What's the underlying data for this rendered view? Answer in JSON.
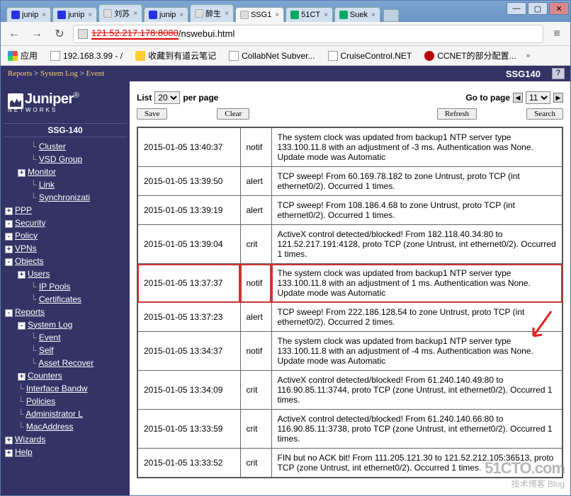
{
  "window": {
    "tabs": [
      {
        "label": "junip",
        "fav": "baidu"
      },
      {
        "label": "junip",
        "fav": "baidu"
      },
      {
        "label": "刘苏",
        "fav": "page"
      },
      {
        "label": "junip",
        "fav": "baidu"
      },
      {
        "label": "醉生",
        "fav": "page"
      },
      {
        "label": "SSG1",
        "fav": "page",
        "active": true
      },
      {
        "label": "51CT",
        "fav": "cto"
      },
      {
        "label": "Suek",
        "fav": "cto"
      }
    ],
    "url_prefix": "121.52.217.178:8080",
    "url_suffix": "/nswebui.html"
  },
  "bookmarks": {
    "apps": "应用",
    "items": [
      {
        "label": "192.168.3.99 - /",
        "icon": "page"
      },
      {
        "label": "收藏到有道云笔记",
        "icon": "folder"
      },
      {
        "label": "CollabNet Subver...",
        "icon": "page"
      },
      {
        "label": "CruiseControl.NET",
        "icon": "page"
      },
      {
        "label": "CCNET的部分配置...",
        "icon": "dot"
      }
    ]
  },
  "header": {
    "breadcrumb_parts": [
      "Reports",
      "System Log",
      "Event"
    ],
    "device": "SSG140",
    "help": "?"
  },
  "sidebar": {
    "logo_text": "Juniper",
    "logo_sub": "NETWORKS",
    "title": "SSG-140",
    "tree": [
      {
        "lvl": 2,
        "box": "",
        "label": "Cluster"
      },
      {
        "lvl": 2,
        "box": "",
        "label": "VSD Group"
      },
      {
        "lvl": 1,
        "box": "+",
        "label": "Monitor"
      },
      {
        "lvl": 2,
        "box": "",
        "label": "Link"
      },
      {
        "lvl": 2,
        "box": "",
        "label": "Synchronizati"
      },
      {
        "lvl": 0,
        "box": "+",
        "label": "PPP"
      },
      {
        "lvl": 0,
        "box": "-",
        "label": "Security"
      },
      {
        "lvl": 0,
        "box": "-",
        "label": "Policy"
      },
      {
        "lvl": 0,
        "box": "+",
        "label": "VPNs"
      },
      {
        "lvl": 0,
        "box": "-",
        "label": "Objects"
      },
      {
        "lvl": 1,
        "box": "+",
        "label": "Users"
      },
      {
        "lvl": 2,
        "box": "",
        "label": "IP Pools"
      },
      {
        "lvl": 2,
        "box": "",
        "label": "Certificates"
      },
      {
        "lvl": 0,
        "box": "-",
        "label": "Reports"
      },
      {
        "lvl": 1,
        "box": "-",
        "label": "System Log"
      },
      {
        "lvl": 2,
        "box": "",
        "label": "Event"
      },
      {
        "lvl": 2,
        "box": "",
        "label": "Self"
      },
      {
        "lvl": 2,
        "box": "",
        "label": "Asset Recover"
      },
      {
        "lvl": 1,
        "box": "+",
        "label": "Counters"
      },
      {
        "lvl": 1,
        "box": "",
        "label": "Interface Bandw"
      },
      {
        "lvl": 1,
        "box": "",
        "label": "Policies"
      },
      {
        "lvl": 1,
        "box": "",
        "label": "Administrator L"
      },
      {
        "lvl": 1,
        "box": "",
        "label": "MacAddress"
      },
      {
        "lvl": 0,
        "box": "+",
        "label": "Wizards"
      },
      {
        "lvl": 0,
        "box": "+",
        "label": "Help"
      }
    ]
  },
  "controls": {
    "list_label": "List",
    "per_page_value": "20",
    "per_page_suffix": "per page",
    "goto_label": "Go to page",
    "page_value": "11",
    "save": "Save",
    "clear": "Clear",
    "refresh": "Refresh",
    "search": "Search"
  },
  "log_rows": [
    {
      "time": "2015-01-05 13:40:37",
      "level": "notif",
      "msg": "The system clock was updated from backup1 NTP server type 133.100.11.8 with an adjustment of -3 ms. Authentication was None. Update mode was Automatic"
    },
    {
      "time": "2015-01-05 13:39:50",
      "level": "alert",
      "msg": "TCP sweep! From 60.169.78.182 to zone Untrust, proto TCP (int ethernet0/2). Occurred 1 times."
    },
    {
      "time": "2015-01-05 13:39:19",
      "level": "alert",
      "msg": "TCP sweep! From 108.186.4.68 to zone Untrust, proto TCP (int ethernet0/2). Occurred 1 times."
    },
    {
      "time": "2015-01-05 13:39:04",
      "level": "crit",
      "msg": "ActiveX control detected/blocked! From 182.118.40.34:80 to 121.52.217.191:4128, proto TCP (zone Untrust, int ethernet0/2). Occurred 1 times."
    },
    {
      "time": "2015-01-05 13:37:37",
      "level": "notif",
      "msg": "The system clock was updated from backup1 NTP server type 133.100.11.8 with an adjustment of 1 ms. Authentication was None. Update mode was Automatic",
      "hl": true
    },
    {
      "time": "2015-01-05 13:37:23",
      "level": "alert",
      "msg": "TCP sweep! From 222.186.128.54 to zone Untrust, proto TCP (int ethernet0/2). Occurred 2 times."
    },
    {
      "time": "2015-01-05 13:34:37",
      "level": "notif",
      "msg": "The system clock was updated from backup1 NTP server type 133.100.11.8 with an adjustment of -4 ms. Authentication was None. Update mode was Automatic"
    },
    {
      "time": "2015-01-05 13:34:09",
      "level": "crit",
      "msg": "ActiveX control detected/blocked! From 61.240.140.49:80 to 116.90.85.11:3744, proto TCP (zone Untrust, int ethernet0/2). Occurred 1 times."
    },
    {
      "time": "2015-01-05 13:33:59",
      "level": "crit",
      "msg": "ActiveX control detected/blocked! From 61.240.140.66:80 to 116.90.85.11:3738, proto TCP (zone Untrust, int ethernet0/2). Occurred 1 times."
    },
    {
      "time": "2015-01-05 13:33:52",
      "level": "crit",
      "msg": "FIN but no ACK bit! From 111.205.121.30 to 121.52.212.105:36513, proto TCP (zone Untrust, int ethernet0/2). Occurred 1 times."
    }
  ],
  "watermark": {
    "big": "51CTO.com",
    "small": "技术博客   Blog"
  }
}
